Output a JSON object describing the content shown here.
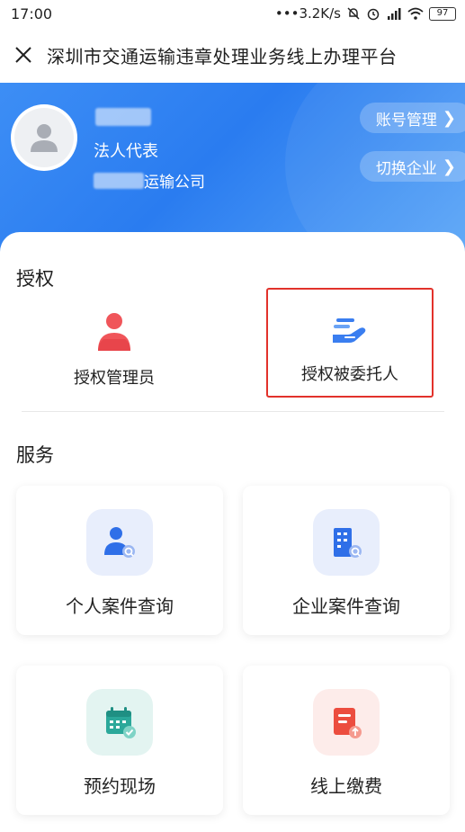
{
  "status_bar": {
    "time": "17:00",
    "network_speed": "3.2K/s",
    "battery": "97"
  },
  "titlebar": {
    "title": "深圳市交通运输违章处理业务线上办理平台"
  },
  "profile": {
    "role": "法人代表",
    "company_suffix": "运输公司",
    "account_button": "账号管理",
    "switch_button": "切换企业"
  },
  "authorization": {
    "section_title": "授权",
    "items": [
      {
        "label": "授权管理员",
        "icon": "person-icon"
      },
      {
        "label": "授权被委托人",
        "icon": "hand-entrust-icon"
      }
    ]
  },
  "services": {
    "section_title": "服务",
    "items": [
      {
        "label": "个人案件查询",
        "icon": "person-search-icon"
      },
      {
        "label": "企业案件查询",
        "icon": "building-search-icon"
      },
      {
        "label": "预约现场",
        "icon": "calendar-check-icon"
      },
      {
        "label": "线上缴费",
        "icon": "bill-upload-icon"
      }
    ]
  },
  "colors": {
    "header_blue": "#2a7cf0",
    "highlight_red": "#e2322b",
    "auth_admin_red": "#f0555a",
    "entrust_blue": "#3a7ef0"
  }
}
